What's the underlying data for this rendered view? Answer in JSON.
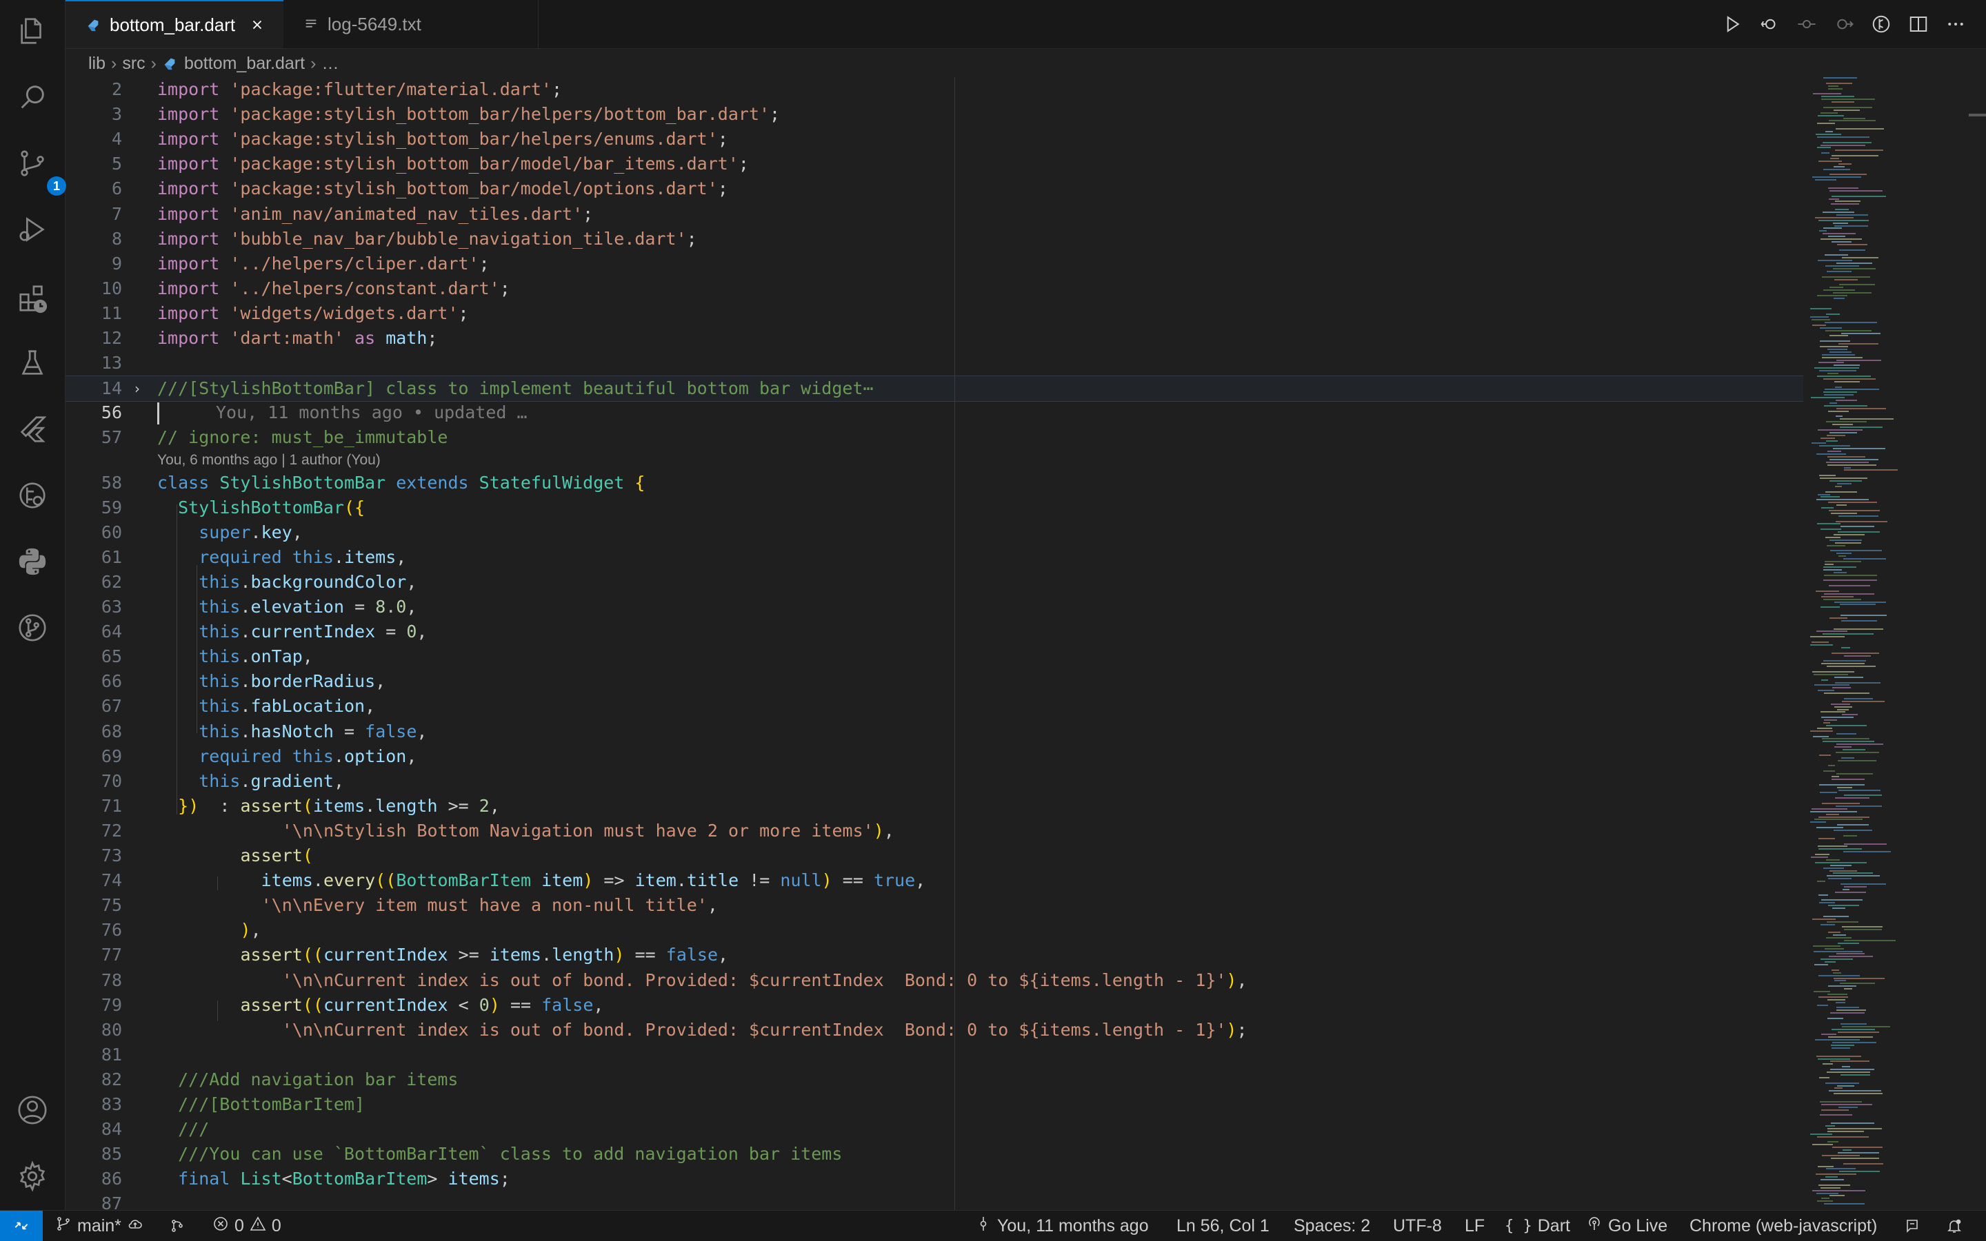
{
  "activity_bar": {
    "scm_badge": "1"
  },
  "tabs": [
    {
      "label": "bottom_bar.dart",
      "active": true
    },
    {
      "label": "log-5649.txt",
      "active": false
    }
  ],
  "breadcrumb": [
    "lib",
    "src",
    "bottom_bar.dart",
    "…"
  ],
  "code_lines": [
    {
      "n": "2",
      "text": "import 'package:flutter/material.dart';"
    },
    {
      "n": "3",
      "text": "import 'package:stylish_bottom_bar/helpers/bottom_bar.dart';"
    },
    {
      "n": "4",
      "text": "import 'package:stylish_bottom_bar/helpers/enums.dart';"
    },
    {
      "n": "5",
      "text": "import 'package:stylish_bottom_bar/model/bar_items.dart';"
    },
    {
      "n": "6",
      "text": "import 'package:stylish_bottom_bar/model/options.dart';"
    },
    {
      "n": "7",
      "text": "import 'anim_nav/animated_nav_tiles.dart';"
    },
    {
      "n": "8",
      "text": "import 'bubble_nav_bar/bubble_navigation_tile.dart';"
    },
    {
      "n": "9",
      "text": "import '../helpers/cliper.dart';"
    },
    {
      "n": "10",
      "text": "import '../helpers/constant.dart';"
    },
    {
      "n": "11",
      "text": "import 'widgets/widgets.dart';"
    },
    {
      "n": "12",
      "text": "import 'dart:math' as math;"
    },
    {
      "n": "13",
      "text": ""
    },
    {
      "n": "14",
      "text": "///[StylishBottomBar] class to implement beautiful bottom bar widget⋯"
    },
    {
      "n": "56",
      "text": "You, 11 months ago • updated …"
    },
    {
      "n": "57",
      "text": "// ignore: must_be_immutable"
    },
    {
      "n": "58",
      "text": "class StylishBottomBar extends StatefulWidget {"
    },
    {
      "n": "59",
      "text": "  StylishBottomBar({"
    },
    {
      "n": "60",
      "text": "    super.key,"
    },
    {
      "n": "61",
      "text": "    required this.items,"
    },
    {
      "n": "62",
      "text": "    this.backgroundColor,"
    },
    {
      "n": "63",
      "text": "    this.elevation = 8.0,"
    },
    {
      "n": "64",
      "text": "    this.currentIndex = 0,"
    },
    {
      "n": "65",
      "text": "    this.onTap,"
    },
    {
      "n": "66",
      "text": "    this.borderRadius,"
    },
    {
      "n": "67",
      "text": "    this.fabLocation,"
    },
    {
      "n": "68",
      "text": "    this.hasNotch = false,"
    },
    {
      "n": "69",
      "text": "    required this.option,"
    },
    {
      "n": "70",
      "text": "    this.gradient,"
    },
    {
      "n": "71",
      "text": "  })  : assert(items.length >= 2,"
    },
    {
      "n": "72",
      "text": "            '\\n\\nStylish Bottom Navigation must have 2 or more items'),"
    },
    {
      "n": "73",
      "text": "        assert("
    },
    {
      "n": "74",
      "text": "          items.every((BottomBarItem item) => item.title != null) == true,"
    },
    {
      "n": "75",
      "text": "          '\\n\\nEvery item must have a non-null title',"
    },
    {
      "n": "76",
      "text": "        ),"
    },
    {
      "n": "77",
      "text": "        assert((currentIndex >= items.length) == false,"
    },
    {
      "n": "78",
      "text": "            '\\n\\nCurrent index is out of bond. Provided: $currentIndex  Bond: 0 to ${items.length - 1}'),"
    },
    {
      "n": "79",
      "text": "        assert((currentIndex < 0) == false,"
    },
    {
      "n": "80",
      "text": "            '\\n\\nCurrent index is out of bond. Provided: $currentIndex  Bond: 0 to ${items.length - 1}');"
    },
    {
      "n": "81",
      "text": ""
    },
    {
      "n": "82",
      "text": "  ///Add navigation bar items"
    },
    {
      "n": "83",
      "text": "  ///[BottomBarItem]"
    },
    {
      "n": "84",
      "text": "  ///"
    },
    {
      "n": "85",
      "text": "  ///You can use `BottomBarItem` class to add navigation bar items"
    },
    {
      "n": "86",
      "text": "  final List<BottomBarItem> items;"
    },
    {
      "n": "87",
      "text": ""
    }
  ],
  "codelens": "You, 6 months ago | 1 author (You)",
  "status_bar": {
    "branch": "main*",
    "errors": "0",
    "warnings": "0",
    "blame": "You, 11 months ago",
    "cursor": "Ln 56, Col 1",
    "spaces": "Spaces: 2",
    "encoding": "UTF-8",
    "eol": "LF",
    "language": "Dart",
    "go_live": "Go Live",
    "device": "Chrome (web-javascript)"
  },
  "colors": {
    "accent": "#0078d4",
    "editor_bg": "#1f1f1f",
    "chrome_bg": "#181818"
  }
}
